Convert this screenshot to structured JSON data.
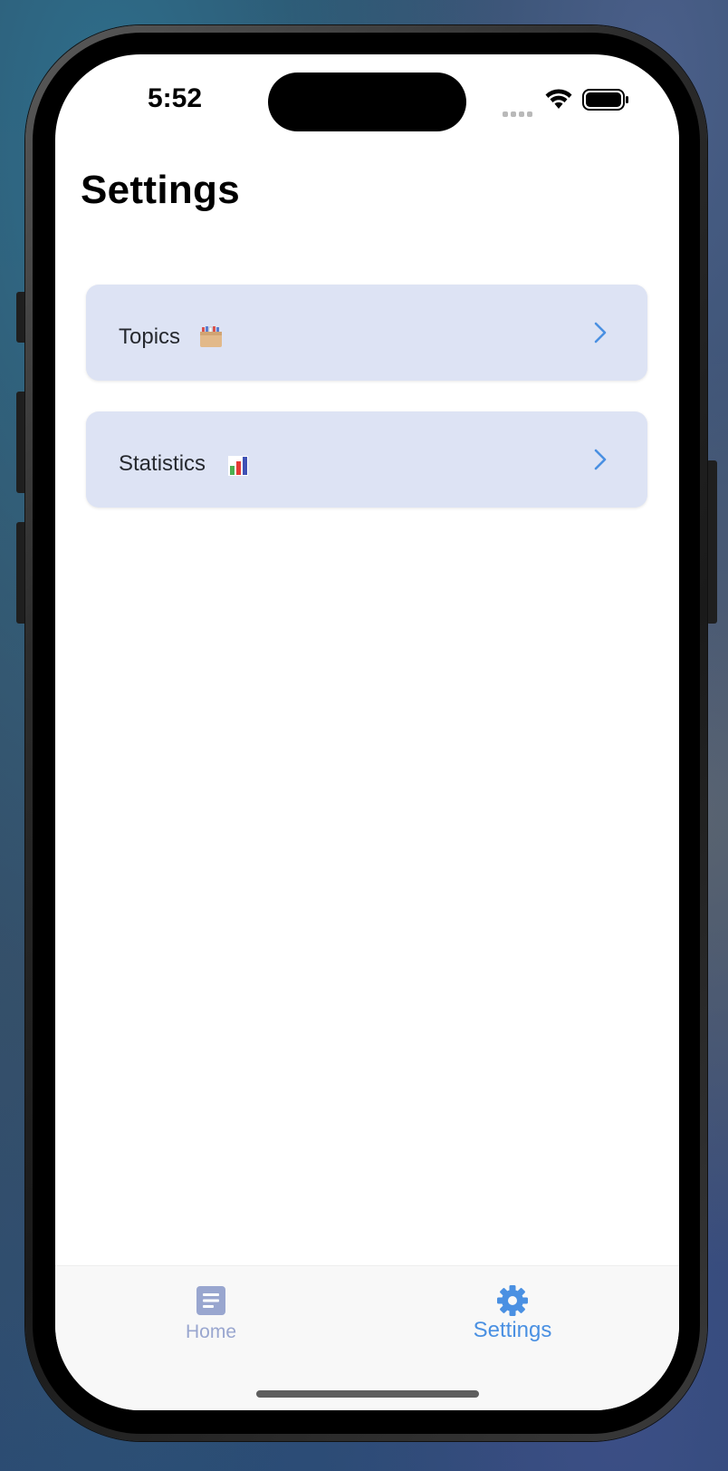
{
  "status_bar": {
    "time": "5:52"
  },
  "header": {
    "title": "Settings"
  },
  "menu": {
    "items": [
      {
        "label": "Topics",
        "icon": "card-file-box-icon"
      },
      {
        "label": "Statistics",
        "icon": "bar-chart-icon"
      }
    ]
  },
  "tab_bar": {
    "tabs": [
      {
        "label": "Home",
        "icon": "document-icon",
        "selected": false
      },
      {
        "label": "Settings",
        "icon": "gear-icon",
        "selected": true
      }
    ]
  },
  "colors": {
    "accent": "#4a90e2",
    "inactive_tab": "#99a6cf",
    "card_background": "#dde3f4"
  }
}
